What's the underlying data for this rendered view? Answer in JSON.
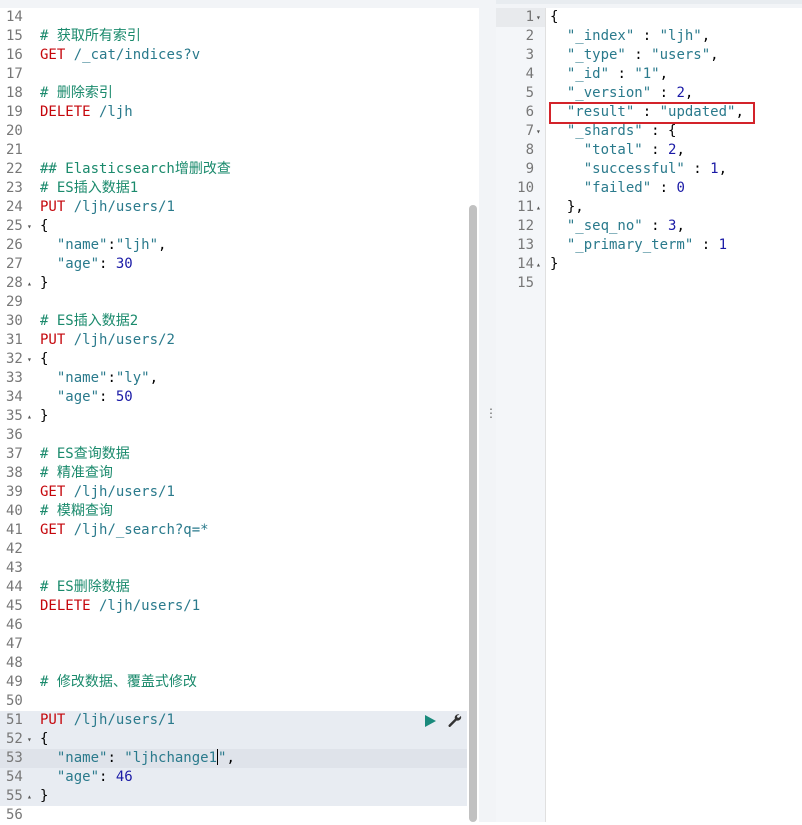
{
  "request_editor": {
    "lines": [
      {
        "n": "14",
        "parts": []
      },
      {
        "n": "15",
        "parts": [
          [
            "c-comment",
            "# 获取所有索引"
          ]
        ]
      },
      {
        "n": "16",
        "parts": [
          [
            "c-method",
            "GET"
          ],
          [
            "c-url",
            " /_cat/indices?v"
          ]
        ]
      },
      {
        "n": "17",
        "parts": []
      },
      {
        "n": "18",
        "parts": [
          [
            "c-comment",
            "# 删除索引"
          ]
        ]
      },
      {
        "n": "19",
        "parts": [
          [
            "c-method",
            "DELETE"
          ],
          [
            "c-url",
            " /ljh"
          ]
        ]
      },
      {
        "n": "20",
        "parts": []
      },
      {
        "n": "21",
        "parts": []
      },
      {
        "n": "22",
        "parts": [
          [
            "c-comment",
            "## Elasticsearch增删改查"
          ]
        ]
      },
      {
        "n": "23",
        "parts": [
          [
            "c-comment",
            "# ES插入数据1"
          ]
        ]
      },
      {
        "n": "24",
        "parts": [
          [
            "c-method",
            "PUT"
          ],
          [
            "c-url",
            " /ljh/users/1"
          ]
        ]
      },
      {
        "n": "25",
        "fold": "▾",
        "parts": [
          [
            "c-punc",
            "{"
          ]
        ]
      },
      {
        "n": "26",
        "parts": [
          [
            "c-key",
            "  \"name\""
          ],
          [
            "c-punc",
            ":"
          ],
          [
            "c-str",
            "\"ljh\""
          ],
          [
            "c-punc",
            ","
          ]
        ]
      },
      {
        "n": "27",
        "parts": [
          [
            "c-key",
            "  \"age\""
          ],
          [
            "c-punc",
            ": "
          ],
          [
            "c-num",
            "30"
          ]
        ]
      },
      {
        "n": "28",
        "fold": "▴",
        "parts": [
          [
            "c-punc",
            "}"
          ]
        ]
      },
      {
        "n": "29",
        "parts": []
      },
      {
        "n": "30",
        "parts": [
          [
            "c-comment",
            "# ES插入数据2"
          ]
        ]
      },
      {
        "n": "31",
        "parts": [
          [
            "c-method",
            "PUT"
          ],
          [
            "c-url",
            " /ljh/users/2"
          ]
        ]
      },
      {
        "n": "32",
        "fold": "▾",
        "parts": [
          [
            "c-punc",
            "{"
          ]
        ]
      },
      {
        "n": "33",
        "parts": [
          [
            "c-key",
            "  \"name\""
          ],
          [
            "c-punc",
            ":"
          ],
          [
            "c-str",
            "\"ly\""
          ],
          [
            "c-punc",
            ","
          ]
        ]
      },
      {
        "n": "34",
        "parts": [
          [
            "c-key",
            "  \"age\""
          ],
          [
            "c-punc",
            ": "
          ],
          [
            "c-num",
            "50"
          ]
        ]
      },
      {
        "n": "35",
        "fold": "▴",
        "parts": [
          [
            "c-punc",
            "}"
          ]
        ]
      },
      {
        "n": "36",
        "parts": []
      },
      {
        "n": "37",
        "parts": [
          [
            "c-comment",
            "# ES查询数据"
          ]
        ]
      },
      {
        "n": "38",
        "parts": [
          [
            "c-comment",
            "# 精准查询"
          ]
        ]
      },
      {
        "n": "39",
        "parts": [
          [
            "c-method",
            "GET"
          ],
          [
            "c-url",
            " /ljh/users/1"
          ]
        ]
      },
      {
        "n": "40",
        "parts": [
          [
            "c-comment",
            "# 模糊查询"
          ]
        ]
      },
      {
        "n": "41",
        "parts": [
          [
            "c-method",
            "GET"
          ],
          [
            "c-url",
            " /ljh/_search?q=*"
          ]
        ]
      },
      {
        "n": "42",
        "parts": []
      },
      {
        "n": "43",
        "parts": []
      },
      {
        "n": "44",
        "parts": [
          [
            "c-comment",
            "# ES删除数据"
          ]
        ]
      },
      {
        "n": "45",
        "parts": [
          [
            "c-method",
            "DELETE"
          ],
          [
            "c-url",
            " /ljh/users/1"
          ]
        ]
      },
      {
        "n": "46",
        "parts": []
      },
      {
        "n": "47",
        "parts": []
      },
      {
        "n": "48",
        "parts": []
      },
      {
        "n": "49",
        "parts": [
          [
            "c-comment",
            "# 修改数据、覆盖式修改"
          ]
        ]
      },
      {
        "n": "50",
        "parts": []
      },
      {
        "n": "51",
        "hl": true,
        "actions": true,
        "parts": [
          [
            "c-method",
            "PUT"
          ],
          [
            "c-url",
            " /ljh/users/1"
          ]
        ]
      },
      {
        "n": "52",
        "hl": true,
        "fold": "▾",
        "parts": [
          [
            "c-punc",
            "{"
          ]
        ]
      },
      {
        "n": "53",
        "hl": true,
        "cur": true,
        "parts": [
          [
            "c-key",
            "  \"name\""
          ],
          [
            "c-punc",
            ": "
          ],
          [
            "c-str",
            "\"ljhchange1"
          ],
          [
            "caret",
            ""
          ],
          [
            "c-str",
            "\""
          ],
          [
            "c-punc",
            ","
          ]
        ]
      },
      {
        "n": "54",
        "hl": true,
        "parts": [
          [
            "c-key",
            "  \"age\""
          ],
          [
            "c-punc",
            ": "
          ],
          [
            "c-num",
            "46"
          ]
        ]
      },
      {
        "n": "55",
        "hl": true,
        "fold": "▴",
        "parts": [
          [
            "c-punc",
            "}"
          ]
        ]
      },
      {
        "n": "56",
        "parts": []
      }
    ]
  },
  "response_viewer": {
    "lines": [
      {
        "n": "1",
        "fold": "▾",
        "active": true,
        "parts": [
          [
            "c-punc",
            "{"
          ]
        ]
      },
      {
        "n": "2",
        "parts": [
          [
            "c-key",
            "  \"_index\""
          ],
          [
            "c-punc",
            " : "
          ],
          [
            "c-str",
            "\"ljh\""
          ],
          [
            "c-punc",
            ","
          ]
        ]
      },
      {
        "n": "3",
        "parts": [
          [
            "c-key",
            "  \"_type\""
          ],
          [
            "c-punc",
            " : "
          ],
          [
            "c-str",
            "\"users\""
          ],
          [
            "c-punc",
            ","
          ]
        ]
      },
      {
        "n": "4",
        "parts": [
          [
            "c-key",
            "  \"_id\""
          ],
          [
            "c-punc",
            " : "
          ],
          [
            "c-str",
            "\"1\""
          ],
          [
            "c-punc",
            ","
          ]
        ]
      },
      {
        "n": "5",
        "parts": [
          [
            "c-key",
            "  \"_version\""
          ],
          [
            "c-punc",
            " : "
          ],
          [
            "c-num",
            "2"
          ],
          [
            "c-punc",
            ","
          ]
        ]
      },
      {
        "n": "6",
        "parts": [
          [
            "c-key",
            "  \"result\""
          ],
          [
            "c-punc",
            " : "
          ],
          [
            "c-str",
            "\"updated\""
          ],
          [
            "c-punc",
            ","
          ]
        ]
      },
      {
        "n": "7",
        "fold": "▾",
        "parts": [
          [
            "c-key",
            "  \"_shards\""
          ],
          [
            "c-punc",
            " : {"
          ]
        ]
      },
      {
        "n": "8",
        "parts": [
          [
            "c-key",
            "    \"total\""
          ],
          [
            "c-punc",
            " : "
          ],
          [
            "c-num",
            "2"
          ],
          [
            "c-punc",
            ","
          ]
        ]
      },
      {
        "n": "9",
        "parts": [
          [
            "c-key",
            "    \"successful\""
          ],
          [
            "c-punc",
            " : "
          ],
          [
            "c-num",
            "1"
          ],
          [
            "c-punc",
            ","
          ]
        ]
      },
      {
        "n": "10",
        "parts": [
          [
            "c-key",
            "    \"failed\""
          ],
          [
            "c-punc",
            " : "
          ],
          [
            "c-num",
            "0"
          ]
        ]
      },
      {
        "n": "11",
        "fold": "▴",
        "parts": [
          [
            "c-punc",
            "  },"
          ]
        ]
      },
      {
        "n": "12",
        "parts": [
          [
            "c-key",
            "  \"_seq_no\""
          ],
          [
            "c-punc",
            " : "
          ],
          [
            "c-num",
            "3"
          ],
          [
            "c-punc",
            ","
          ]
        ]
      },
      {
        "n": "13",
        "parts": [
          [
            "c-key",
            "  \"_primary_term\""
          ],
          [
            "c-punc",
            " : "
          ],
          [
            "c-num",
            "1"
          ]
        ]
      },
      {
        "n": "14",
        "fold": "▴",
        "parts": [
          [
            "c-punc",
            "}"
          ]
        ]
      },
      {
        "n": "15",
        "parts": []
      }
    ]
  },
  "icons": {
    "run": "play-icon",
    "settings": "wrench-icon",
    "resize": "resize-handle-icon"
  },
  "colors": {
    "comment": "#1a8a6c",
    "method": "#c5060b",
    "string": "#2a7a8c",
    "number": "#1a1aa6",
    "highlight_box": "#d3232a",
    "run": "#1a8a7c"
  }
}
